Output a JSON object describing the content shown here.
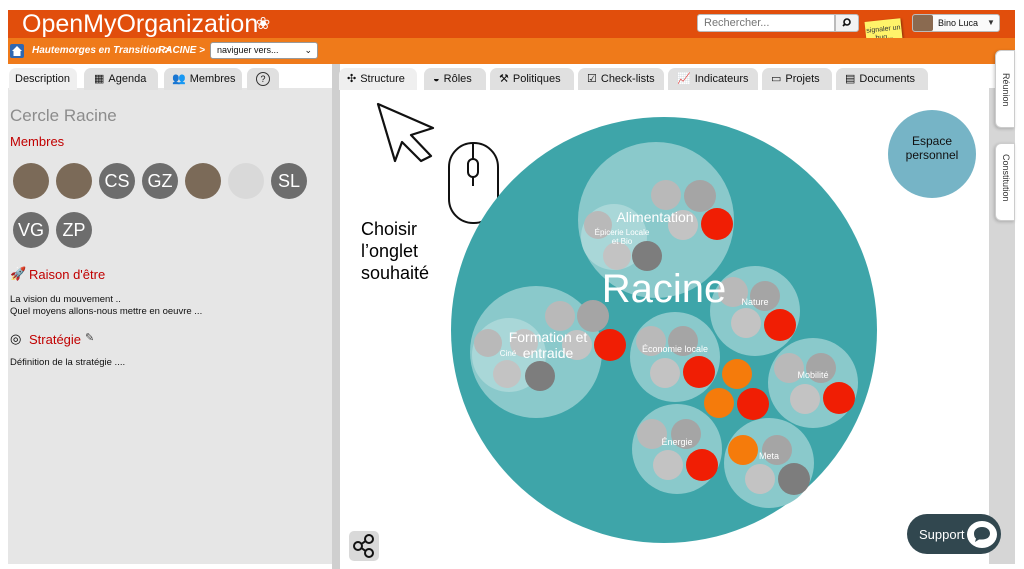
{
  "header": {
    "app_title": "OpenMyOrganization",
    "search_placeholder": "Rechercher...",
    "bug_note": "signaler un bug...",
    "user_name": "Bino Luca"
  },
  "breadcrumb": {
    "organization": "Hautemorges en Transition",
    "circle": "RACINE",
    "navigate_placeholder": "naviguer vers..."
  },
  "left_tabs": [
    {
      "label": "Description",
      "icon": "none"
    },
    {
      "label": "Agenda",
      "icon": "calendar-icon"
    },
    {
      "label": "Membres",
      "icon": "users-icon"
    },
    {
      "label": "",
      "icon": "help-icon"
    }
  ],
  "main_tabs": [
    {
      "label": "Structure",
      "icon": "structure-icon"
    },
    {
      "label": "Rôles",
      "icon": "roles-icon"
    },
    {
      "label": "Politiques",
      "icon": "gavel-icon"
    },
    {
      "label": "Check-lists",
      "icon": "checklist-icon"
    },
    {
      "label": "Indicateurs",
      "icon": "chart-icon"
    },
    {
      "label": "Projets",
      "icon": "folder-icon"
    },
    {
      "label": "Documents",
      "icon": "document-icon"
    }
  ],
  "side_tabs": {
    "meeting": "Réunion",
    "constitution": "Constitution"
  },
  "description": {
    "circle_title": "Cercle Racine",
    "members_heading": "Membres",
    "members": [
      "",
      "",
      "CS",
      "GZ",
      "",
      "",
      "SL",
      "VG",
      "ZP"
    ],
    "purpose_heading": "Raison d'être",
    "purpose_line1": "La vision du mouvement ..",
    "purpose_line2": "Quel moyens allons-nous mettre en oeuvre ...",
    "strategy_heading": "Stratégie",
    "strategy_text": "Définition de la stratégie ...."
  },
  "annotation": {
    "line1": "Choisir",
    "line2": "l’onglet",
    "line3": "souhaité"
  },
  "structure": {
    "root_label": "Racine",
    "personal_space_line1": "Espace",
    "personal_space_line2": "personnel",
    "circles": {
      "alimentation": "Alimentation",
      "epicerie_line1": "Épicerie Locale",
      "epicerie_line2": "et Bio",
      "nature": "Nature",
      "formation_line1": "Formation et",
      "formation_line2": "entraide",
      "formation_sub": "Ciné",
      "economie": "Économie locale",
      "mobilite": "Mobilité",
      "energie": "Énergie",
      "meta": "Meta"
    }
  },
  "support_label": "Support",
  "colors": {
    "header": "#e14e0c",
    "subbar": "#ef7a1a",
    "root_circle": "#3ea5a9",
    "inner_circle": "#8ac9cb",
    "role_red": "#f01e04",
    "role_orange": "#f57b0b",
    "role_grey": "#b9b9b9",
    "personal_space": "#76b4c6",
    "support": "#31474f",
    "accent_red": "#c10000"
  }
}
